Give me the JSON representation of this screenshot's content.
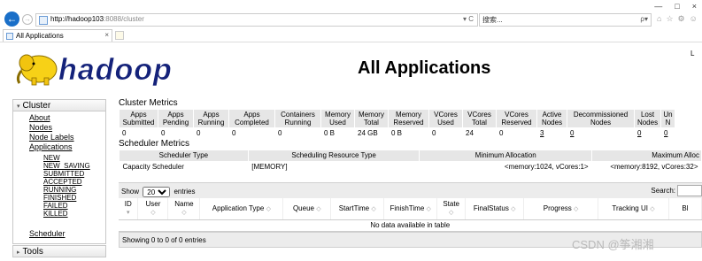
{
  "browser": {
    "url_host": "http://hadoop103",
    "url_rest": ":8088/cluster",
    "addr_controls": "▾ C",
    "search_placeholder": "搜索...",
    "search_icon": "ρ▾",
    "tab_title": "All Applications",
    "tab_close": "×",
    "window_controls": [
      "—",
      "□",
      "×"
    ],
    "toolbar_icons": [
      "home-icon",
      "star-icon",
      "gear-icon",
      "smiley-icon"
    ]
  },
  "page": {
    "title": "All Applications",
    "corner_text": "L"
  },
  "sidebar": {
    "cluster_label": "Cluster",
    "links": [
      "About",
      "Nodes",
      "Node Labels",
      "Applications"
    ],
    "app_states": [
      "NEW",
      "NEW_SAVING",
      "SUBMITTED",
      "ACCEPTED",
      "RUNNING",
      "FINISHED",
      "FAILED",
      "KILLED"
    ],
    "scheduler": "Scheduler",
    "tools_label": "Tools"
  },
  "cluster_metrics": {
    "title": "Cluster Metrics",
    "headers": [
      [
        "Apps",
        "Submitted"
      ],
      [
        "Apps",
        "Pending"
      ],
      [
        "Apps",
        "Running"
      ],
      [
        "Apps",
        "Completed"
      ],
      [
        "Containers",
        "Running"
      ],
      [
        "Memory",
        "Used"
      ],
      [
        "Memory",
        "Total"
      ],
      [
        "Memory",
        "Reserved"
      ],
      [
        "VCores",
        "Used"
      ],
      [
        "VCores",
        "Total"
      ],
      [
        "VCores",
        "Reserved"
      ],
      [
        "Active",
        "Nodes"
      ],
      [
        "Decommissioned",
        "Nodes"
      ],
      [
        "Lost",
        "Nodes"
      ],
      [
        "Un",
        "N"
      ]
    ],
    "values": [
      "0",
      "0",
      "0",
      "0",
      "0",
      "0 B",
      "24 GB",
      "0 B",
      "0",
      "24",
      "0",
      "3",
      "0",
      "0",
      "0"
    ]
  },
  "scheduler_metrics": {
    "title": "Scheduler Metrics",
    "headers": [
      "Scheduler Type",
      "Scheduling Resource Type",
      "Minimum Allocation",
      "Maximum Alloc"
    ],
    "values": [
      "Capacity Scheduler",
      "[MEMORY]",
      "<memory:1024, vCores:1>",
      "<memory:8192, vCores:32>"
    ]
  },
  "apps_table": {
    "show_label": "Show",
    "entries_value": "20",
    "entries_label": "entries",
    "search_label": "Search:",
    "columns": [
      "ID",
      "User",
      "Name",
      "Application Type",
      "Queue",
      "StartTime",
      "FinishTime",
      "State",
      "FinalStatus",
      "Progress",
      "Tracking UI",
      "Bl"
    ],
    "empty_text": "No data available in table",
    "footer_text": "Showing 0 to 0 of 0 entries"
  },
  "watermark": "CSDN @筝湘湘"
}
